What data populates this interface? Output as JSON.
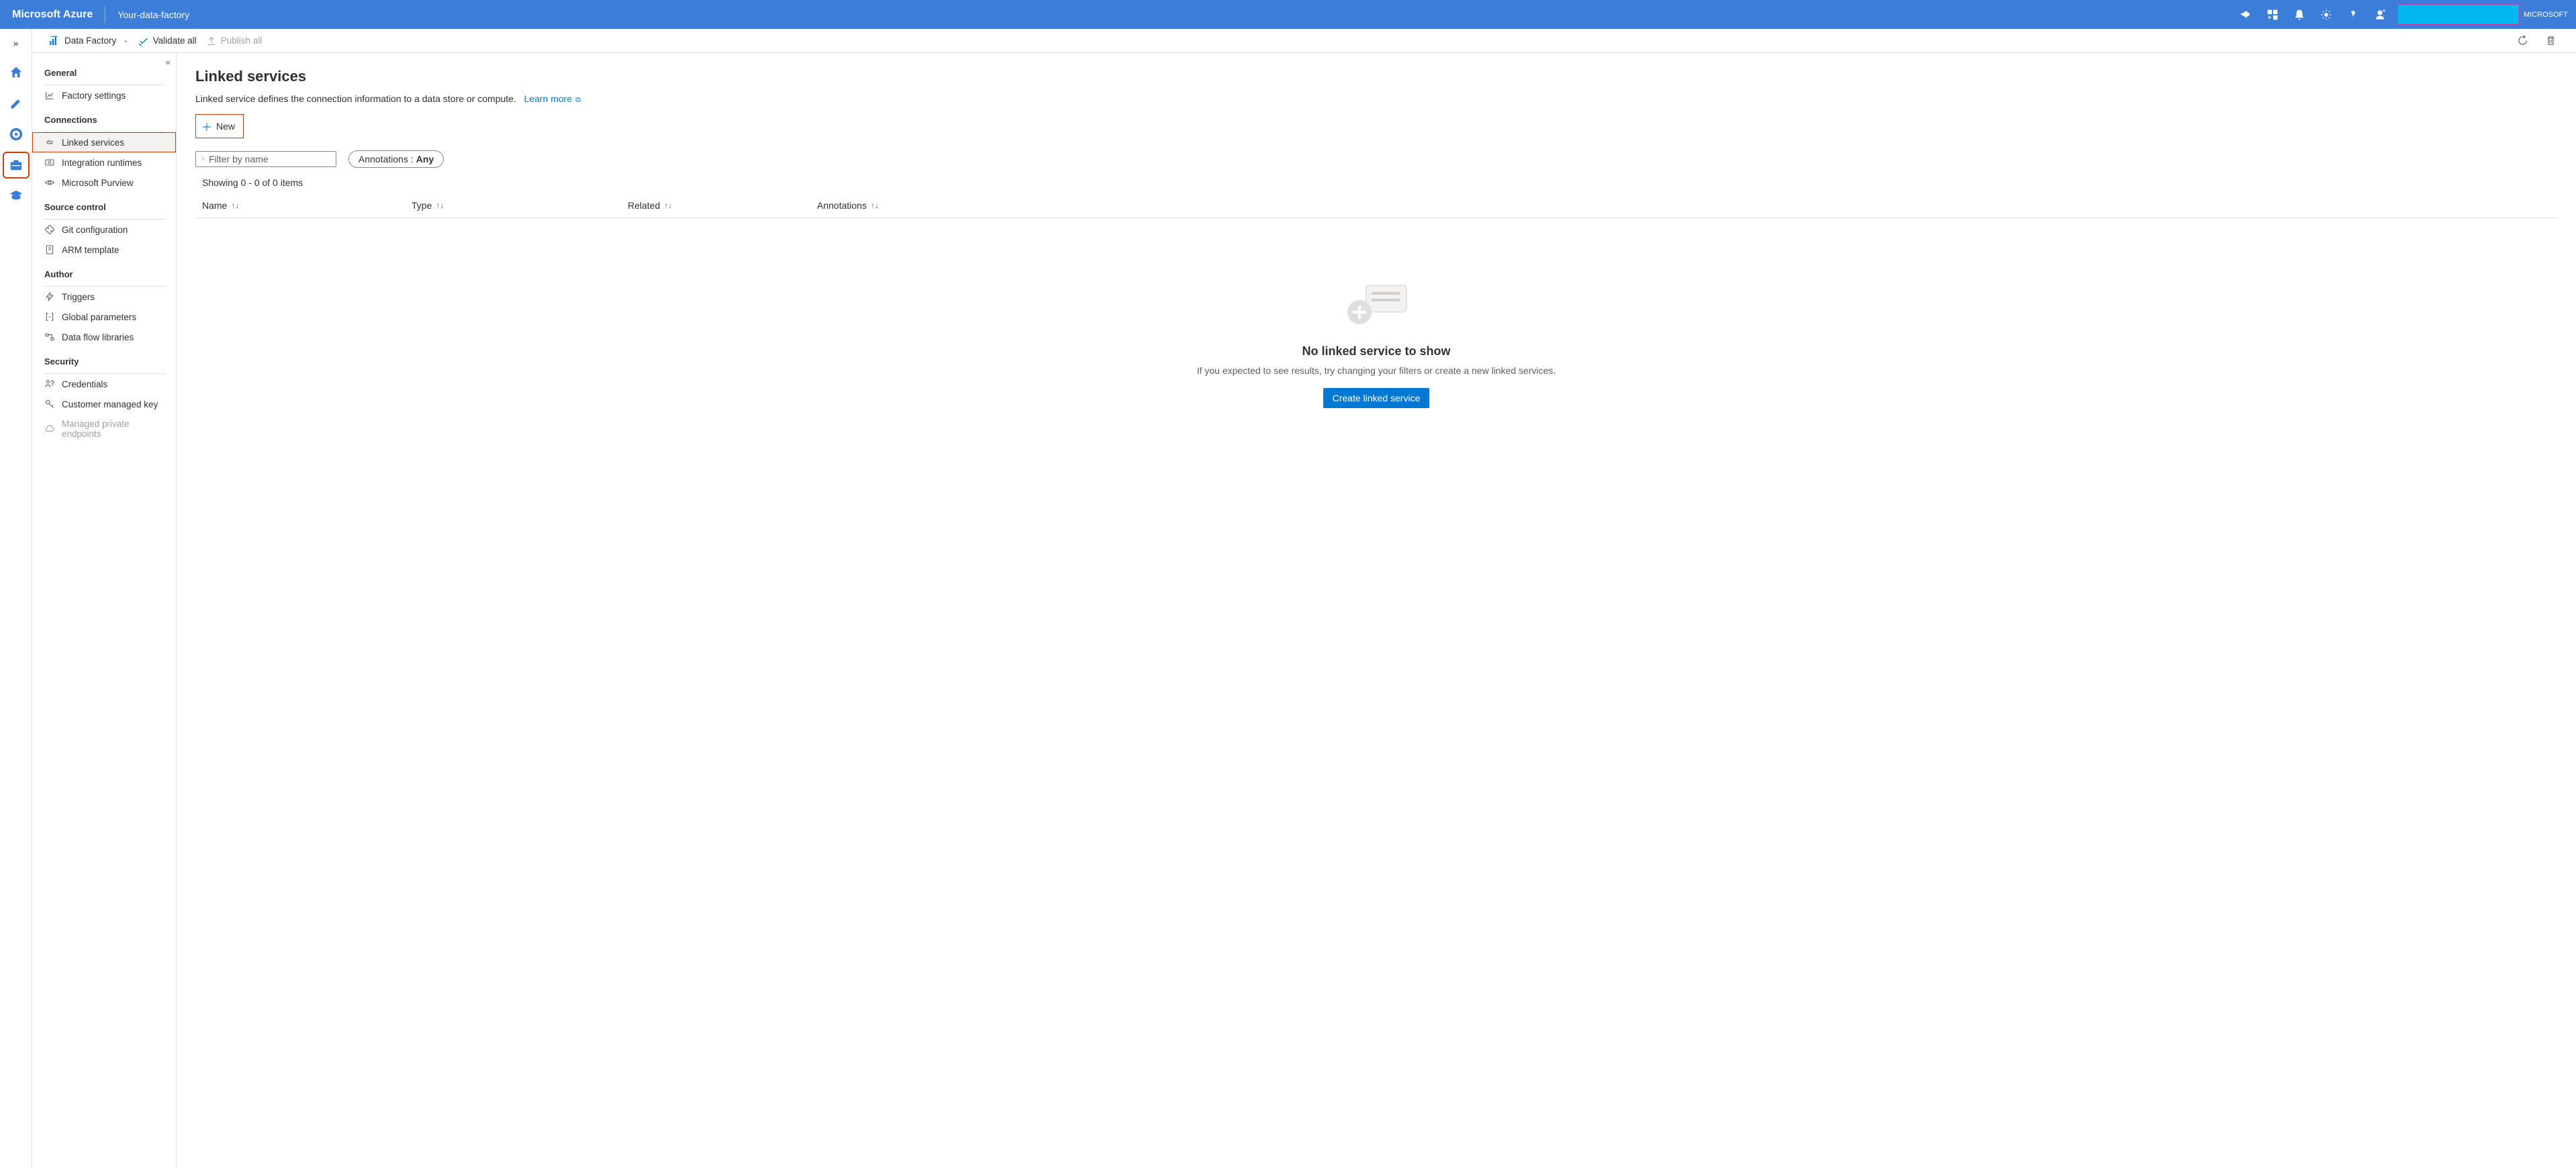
{
  "header": {
    "brand": "Microsoft Azure",
    "context": "Your-data-factory",
    "tenant": "MICROSOFT"
  },
  "commandBar": {
    "workspace": "Data Factory",
    "validateAll": "Validate all",
    "publishAll": "Publish all"
  },
  "sidebar": {
    "sections": [
      {
        "title": "General",
        "items": [
          {
            "label": "Factory settings"
          }
        ]
      },
      {
        "title": "Connections",
        "items": [
          {
            "label": "Linked services"
          },
          {
            "label": "Integration runtimes"
          },
          {
            "label": "Microsoft Purview"
          }
        ]
      },
      {
        "title": "Source control",
        "items": [
          {
            "label": "Git configuration"
          },
          {
            "label": "ARM template"
          }
        ]
      },
      {
        "title": "Author",
        "items": [
          {
            "label": "Triggers"
          },
          {
            "label": "Global parameters"
          },
          {
            "label": "Data flow libraries"
          }
        ]
      },
      {
        "title": "Security",
        "items": [
          {
            "label": "Credentials"
          },
          {
            "label": "Customer managed key"
          },
          {
            "label": "Managed private endpoints"
          }
        ]
      }
    ]
  },
  "page": {
    "title": "Linked services",
    "description": "Linked service defines the connection information to a data store or compute.",
    "learnMore": "Learn more",
    "newLabel": "New",
    "filterPlaceholder": "Filter by name",
    "annotationsLabel": "Annotations :",
    "annotationsValue": "Any",
    "countText": "Showing 0 - 0 of 0 items",
    "columns": {
      "name": "Name",
      "type": "Type",
      "related": "Related",
      "annotations": "Annotations"
    },
    "empty": {
      "title": "No linked service to show",
      "desc": "If you expected to see results, try changing your filters or create a new linked services.",
      "button": "Create linked service"
    }
  }
}
